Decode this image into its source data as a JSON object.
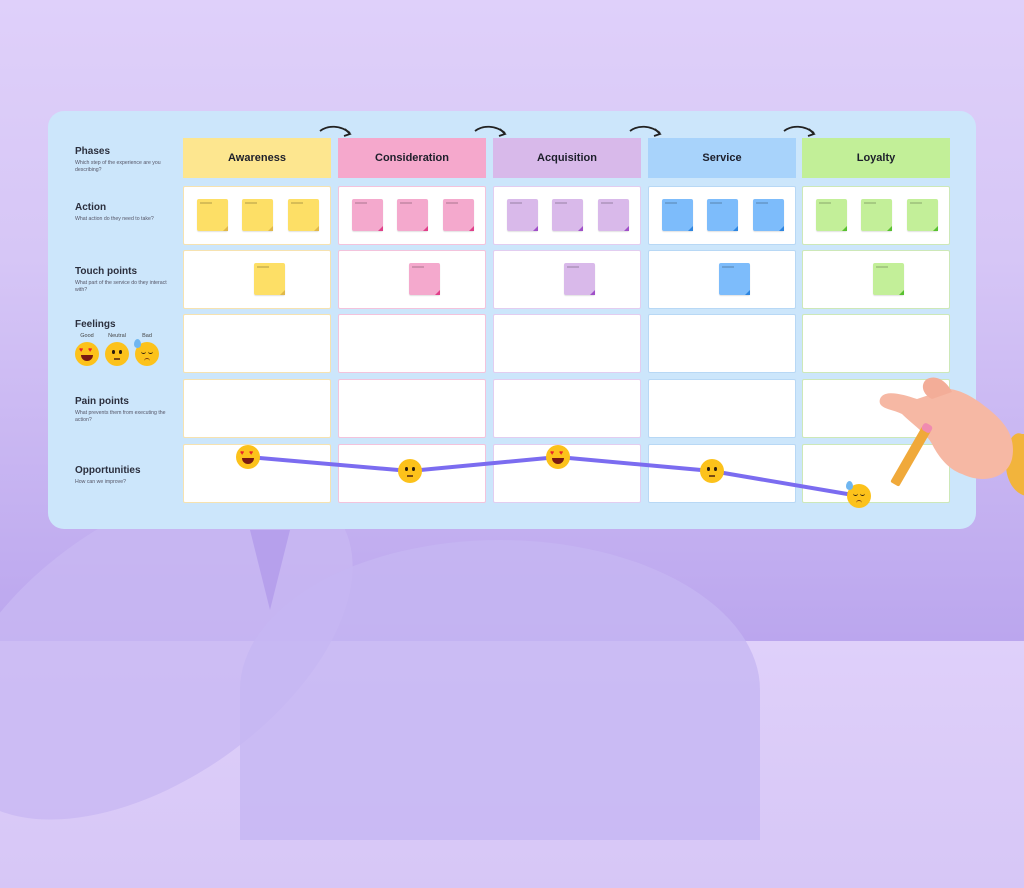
{
  "board": {
    "rows": [
      {
        "title": "Phases",
        "subtitle": "Which step of the experience are you describing?"
      },
      {
        "title": "Action",
        "subtitle": "What action do they need to take?"
      },
      {
        "title": "Touch points",
        "subtitle": "What part of the service do they interact with?"
      },
      {
        "title": "Feelings",
        "subtitle": ""
      },
      {
        "title": "Pain points",
        "subtitle": "What prevents them from executing the action?"
      },
      {
        "title": "Opportunities",
        "subtitle": "How can we improve?"
      }
    ],
    "feelings_legend": [
      {
        "label": "Good",
        "icon": "heart-eyes-emoji"
      },
      {
        "label": "Neutral",
        "icon": "neutral-face-emoji"
      },
      {
        "label": "Bad",
        "icon": "sad-sweat-emoji"
      }
    ],
    "phases": [
      {
        "label": "Awareness",
        "color": "#fde68f",
        "note_color": "#fddf66",
        "fold": "#e0b84a",
        "border": "#f6e2b0",
        "action_notes": 3,
        "touch_notes": 1,
        "feeling": "good"
      },
      {
        "label": "Consideration",
        "color": "#f5a8cc",
        "note_color": "#f4a9cd",
        "fold": "#e0408a",
        "border": "#f3c3dc",
        "action_notes": 3,
        "touch_notes": 1,
        "feeling": "neutral"
      },
      {
        "label": "Acquisition",
        "color": "#d8b9ea",
        "note_color": "#d9b9ea",
        "fold": "#a050c8",
        "border": "#e2cdf0",
        "action_notes": 3,
        "touch_notes": 1,
        "feeling": "good"
      },
      {
        "label": "Service",
        "color": "#a8d3fb",
        "note_color": "#7dbcfb",
        "fold": "#2f86e0",
        "border": "#b8d8f5",
        "action_notes": 3,
        "touch_notes": 1,
        "feeling": "neutral"
      },
      {
        "label": "Loyalty",
        "color": "#c2ef98",
        "note_color": "#c3ef99",
        "fold": "#58c030",
        "border": "#cde8b8",
        "action_notes": 3,
        "touch_notes": 1,
        "feeling": "bad"
      }
    ],
    "line_color": "#7b6cf0"
  }
}
